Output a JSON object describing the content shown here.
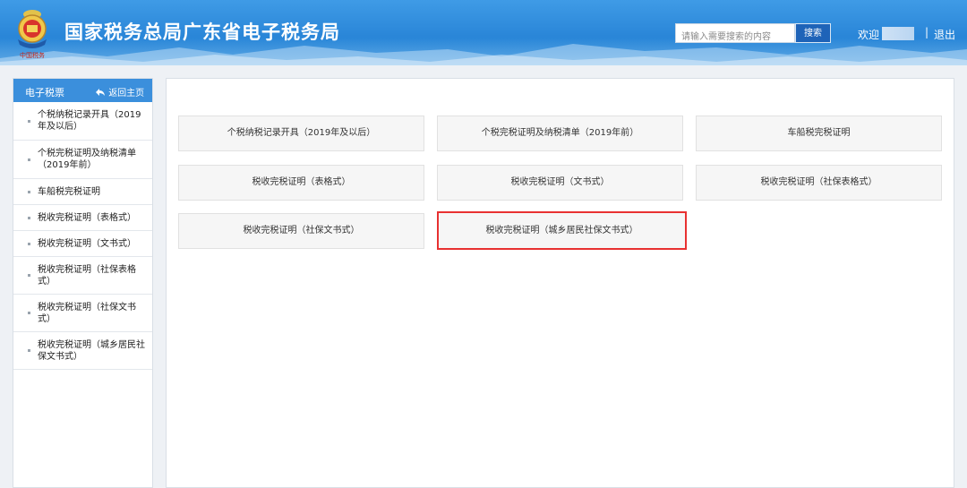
{
  "header": {
    "title": "国家税务总局广东省电子税务局",
    "search_placeholder": "请输入需要搜索的内容",
    "search_button": "搜索",
    "welcome": "欢迎",
    "separator": "|",
    "logout": "退出",
    "emblem_icon": "tax-emblem-icon",
    "colors": {
      "header_bg": "#2a86d8",
      "search_button": "#1e63b8"
    }
  },
  "sidebar": {
    "title": "电子税票",
    "back_label": "返回主页",
    "back_icon": "back-arrow-icon",
    "items": [
      {
        "label": "个税纳税记录开具（2019年及以后）"
      },
      {
        "label": "个税完税证明及纳税清单（2019年前）"
      },
      {
        "label": "车船税完税证明"
      },
      {
        "label": "税收完税证明（表格式）"
      },
      {
        "label": "税收完税证明（文书式）"
      },
      {
        "label": "税收完税证明（社保表格式）"
      },
      {
        "label": "税收完税证明（社保文书式）"
      },
      {
        "label": "税收完税证明（城乡居民社保文书式）"
      }
    ]
  },
  "main": {
    "cards": [
      {
        "label": "个税纳税记录开具（2019年及以后）"
      },
      {
        "label": "个税完税证明及纳税清单（2019年前）"
      },
      {
        "label": "车船税完税证明"
      },
      {
        "label": "税收完税证明（表格式）"
      },
      {
        "label": "税收完税证明（文书式）"
      },
      {
        "label": "税收完税证明（社保表格式）"
      },
      {
        "label": "税收完税证明（社保文书式）"
      },
      {
        "label": "税收完税证明（城乡居民社保文书式）",
        "highlighted": true
      }
    ],
    "highlight_color": "#e83131"
  }
}
